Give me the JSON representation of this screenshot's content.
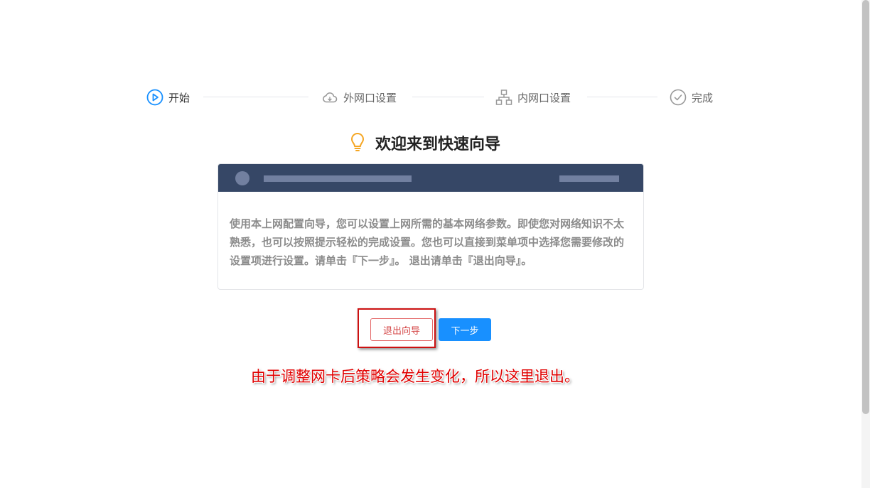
{
  "steps": [
    {
      "label": "开始",
      "icon": "play-circle-icon",
      "state": "active"
    },
    {
      "label": "外网口设置",
      "icon": "cloud-icon",
      "state": "pending"
    },
    {
      "label": "内网口设置",
      "icon": "network-tree-icon",
      "state": "pending"
    },
    {
      "label": "完成",
      "icon": "check-circle-icon",
      "state": "pending"
    }
  ],
  "main": {
    "title": "欢迎来到快速向导",
    "title_icon": "lightbulb-icon",
    "description": "使用本上网配置向导，您可以设置上网所需的基本网络参数。即使您对网络知识不太熟悉，也可以按照提示轻松的完成设置。您也可以直接到菜单项中选择您需要修改的设置项进行设置。请单击『下一步』。 退出请单击『退出向导』。"
  },
  "buttons": {
    "exit_label": "退出向导",
    "next_label": "下一步"
  },
  "annotation": {
    "text": "由于调整网卡后策略会发生变化，所以这里退出。"
  },
  "colors": {
    "primary": "#1890ff",
    "active_icon": "#1890ff",
    "inactive_icon": "#999999",
    "header_bg": "#364766",
    "lightbulb": "#f5a623",
    "danger": "#d44545",
    "annotation": "#e00000"
  }
}
